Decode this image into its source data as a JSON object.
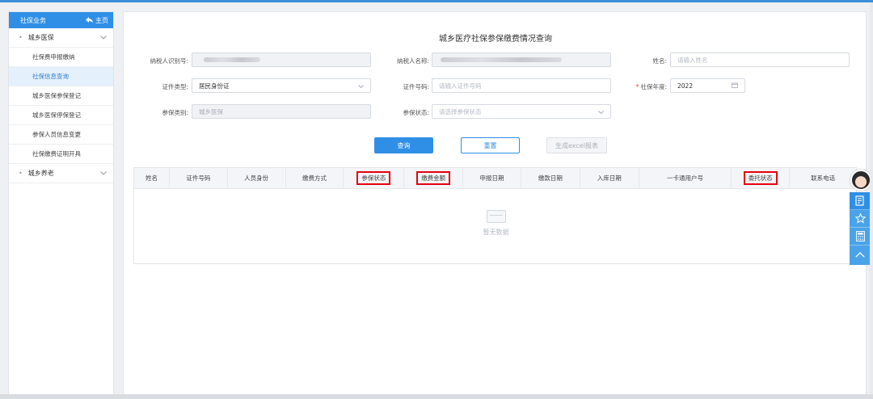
{
  "sidebar": {
    "title": "社保业务",
    "home_label": "主页",
    "groups": [
      {
        "label": "城乡医保",
        "items": [
          {
            "label": "社保费申报缴纳"
          },
          {
            "label": "社保信息查询",
            "active": true
          },
          {
            "label": "城乡医保参保登记"
          },
          {
            "label": "城乡医保停保登记"
          },
          {
            "label": "参保人员信息变更"
          },
          {
            "label": "社保缴费证明开具"
          }
        ]
      },
      {
        "label": "城乡养老",
        "items": []
      }
    ]
  },
  "main": {
    "title": "城乡医疗社保参保缴费情况查询",
    "form": {
      "taxpayer_id": {
        "label": "纳税人识别号:",
        "value": ""
      },
      "taxpayer_name": {
        "label": "纳税人名称:",
        "value": ""
      },
      "name": {
        "label": "姓名:",
        "placeholder": "请输入姓名"
      },
      "id_type": {
        "label": "证件类型:",
        "value": "居民身份证"
      },
      "id_number": {
        "label": "证件号码:",
        "placeholder": "请输入证件号码"
      },
      "year": {
        "label": "社保年度:",
        "value": "2022",
        "required": true
      },
      "insurance_type": {
        "label": "参保类别:",
        "value": "城乡医保"
      },
      "insurance_status": {
        "label": "参保状态:",
        "placeholder": "请选择参保状态"
      }
    },
    "buttons": {
      "query": "查询",
      "reset": "重置",
      "export": "生成excel报表"
    },
    "table": {
      "columns": [
        {
          "label": "姓名",
          "highlight": false
        },
        {
          "label": "证件号码",
          "highlight": false
        },
        {
          "label": "人员身份",
          "highlight": false
        },
        {
          "label": "缴费方式",
          "highlight": false
        },
        {
          "label": "参保状态",
          "highlight": true
        },
        {
          "label": "缴费金额",
          "highlight": true
        },
        {
          "label": "申报日期",
          "highlight": false
        },
        {
          "label": "缴款日期",
          "highlight": false
        },
        {
          "label": "入库日期",
          "highlight": false
        },
        {
          "label": "一卡通用户号",
          "highlight": false
        },
        {
          "label": "委托状态",
          "highlight": true
        },
        {
          "label": "联系电话",
          "highlight": false
        }
      ],
      "empty_text": "暂无数据"
    }
  },
  "colors": {
    "primary": "#2f8fe6",
    "highlight_border": "#e60012",
    "required": "#e03b3b"
  },
  "float_tools": [
    "assistant-avatar",
    "document-icon",
    "star-icon",
    "calculator-icon",
    "chevron-up-icon"
  ]
}
